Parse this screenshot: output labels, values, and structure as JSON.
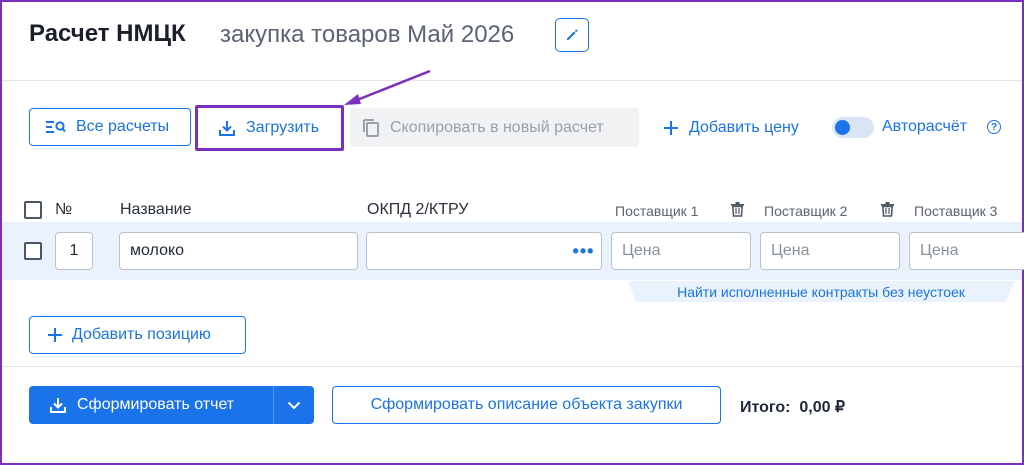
{
  "header": {
    "title": "Расчет НМЦК",
    "subtitle": "закупка товаров Май 2026"
  },
  "toolbar": {
    "all_calculations": "Все расчеты",
    "upload": "Загрузить",
    "copy_to_new": "Скопировать в новый расчет",
    "add_price": "Добавить цену",
    "auto_calc": "Авторасчёт",
    "auto_calc_enabled": true,
    "help": "?"
  },
  "table": {
    "columns": {
      "number": "№",
      "name": "Название",
      "okpd": "ОКПД 2/КТРУ",
      "supplier1": "Поставщик 1",
      "supplier2": "Поставщик 2",
      "supplier3": "Поставщик 3"
    },
    "rows": [
      {
        "number": "1",
        "name": "молоко",
        "okpd": "",
        "price_placeholder": "Цена"
      }
    ],
    "find_contracts": "Найти исполненные контракты без неустоек"
  },
  "add_position": "Добавить позицию",
  "footer": {
    "generate_report": "Сформировать отчет",
    "generate_description": "Сформировать описание объекта закупки",
    "total_label": "Итого:",
    "total_value": "0,00 ₽"
  },
  "colors": {
    "accent": "#1a73e8",
    "highlight": "#7b2fbf",
    "row_bg": "#eaf2fd"
  }
}
